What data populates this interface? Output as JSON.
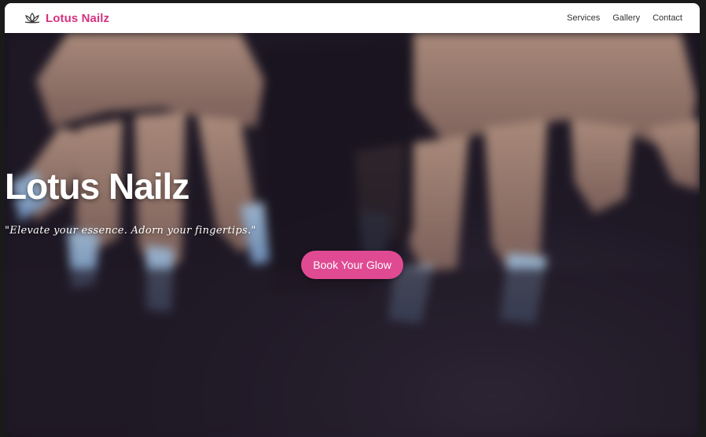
{
  "header": {
    "brand_name": "Lotus Nailz",
    "brand_icon": "lotus-icon",
    "brand_color": "#d4327f",
    "nav": [
      {
        "label": "Services"
      },
      {
        "label": "Gallery"
      },
      {
        "label": "Contact"
      }
    ]
  },
  "hero": {
    "title": "Lotus Nailz",
    "tagline": "\"Elevate your essence. Adorn your fingertips.\"",
    "cta_label": "Book Your Glow",
    "cta_color": "#e04a93"
  }
}
